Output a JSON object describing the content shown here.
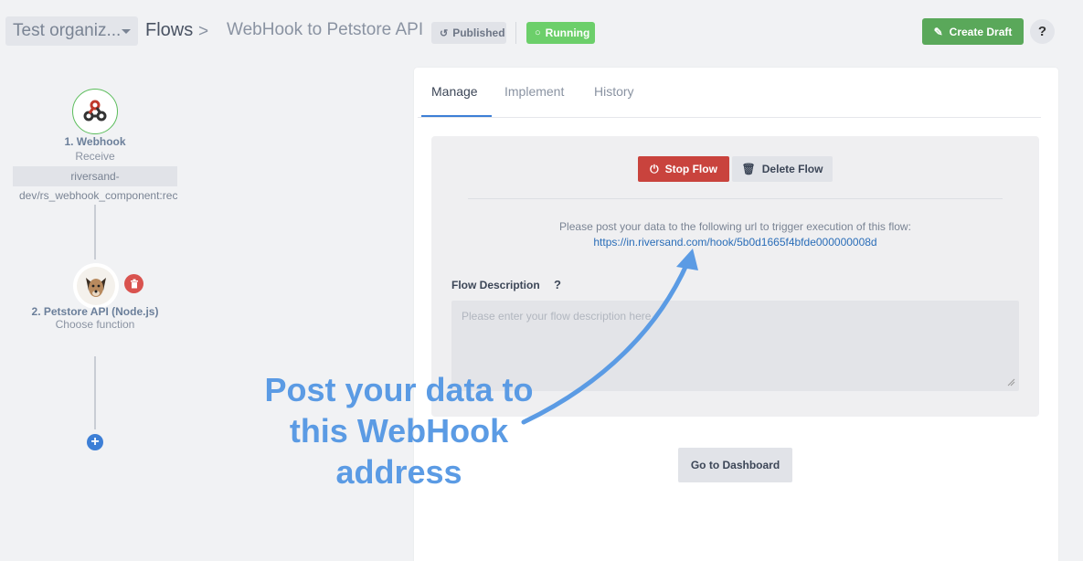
{
  "header": {
    "org_name": "Test organiz...",
    "breadcrumb_flows": "Flows",
    "breadcrumb_separator": ">",
    "flow_name": "WebHook to Petstore API",
    "published_badge": "Published",
    "running_badge": "Running",
    "create_draft_label": "Create Draft",
    "help_label": "?"
  },
  "flow": {
    "nodes": [
      {
        "title": "1. Webhook",
        "subtitle": "Receive",
        "endpoint_line1": "riversand-",
        "endpoint_line2": "dev/rs_webhook_component:receive",
        "icon": "webhook-icon"
      },
      {
        "title": "2. Petstore API (Node.js)",
        "subtitle": "Choose function",
        "icon": "dog-avatar-icon"
      }
    ],
    "add_label": "+"
  },
  "panel": {
    "tabs": [
      {
        "label": "Manage",
        "active": true
      },
      {
        "label": "Implement",
        "active": false
      },
      {
        "label": "History",
        "active": false
      }
    ],
    "stop_flow_label": "Stop Flow",
    "delete_flow_label": "Delete Flow",
    "trigger_text": "Please post your data to the following url to trigger execution of this flow:",
    "trigger_url": "https://in.riversand.com/hook/5b0d1665f4bfde000000008d",
    "description_label": "Flow Description",
    "description_help": "?",
    "description_value": "",
    "description_placeholder": "Please enter your flow description here.",
    "go_to_dashboard_label": "Go to Dashboard"
  },
  "annotation": {
    "line1": "Post your data to",
    "line2": "this WebHook",
    "line3": "address",
    "color": "#5b9be4"
  },
  "colors": {
    "accent_blue": "#3d7fd6",
    "success_green": "#5aa85a",
    "running_green": "#6ccf6a",
    "danger_red": "#c9433d",
    "link_blue": "#2a6db8"
  }
}
